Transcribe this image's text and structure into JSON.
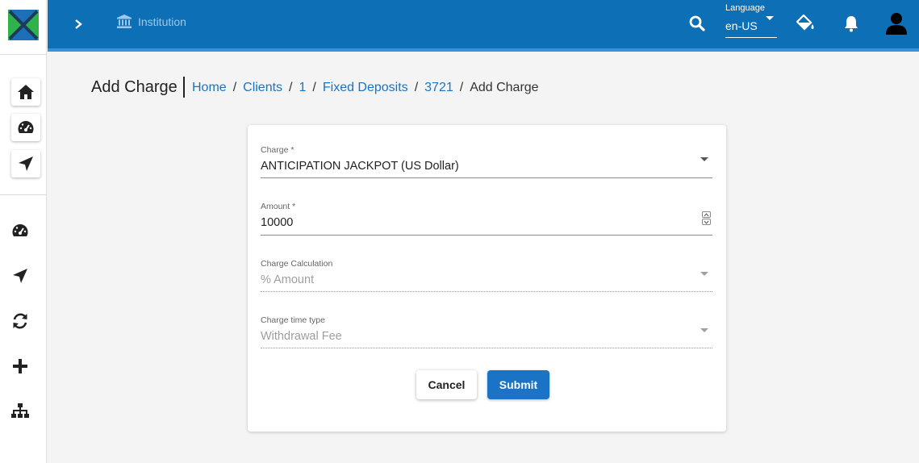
{
  "topbar": {
    "institution_label": "Institution",
    "language_label": "Language",
    "language_value": "en-US"
  },
  "sidebar": {
    "quick_buttons": [
      "home-icon",
      "dashboard-icon",
      "navigation-icon"
    ],
    "nav_icons": [
      "dashboard-icon",
      "navigation-icon",
      "refresh-icon",
      "plus-icon",
      "sitemap-icon"
    ]
  },
  "header": {
    "title": "Add Charge",
    "breadcrumb": {
      "home": "Home",
      "clients": "Clients",
      "client_id": "1",
      "fixed_deposits": "Fixed Deposits",
      "account_id": "3721",
      "current": "Add Charge",
      "separator": "/"
    }
  },
  "form": {
    "charge": {
      "label": "Charge *",
      "value": "ANTICIPATION JACKPOT (US Dollar)"
    },
    "amount": {
      "label": "Amount *",
      "value": "10000"
    },
    "charge_calculation": {
      "label": "Charge Calculation",
      "value": "% Amount"
    },
    "charge_time_type": {
      "label": "Charge time type",
      "value": "Withdrawal Fee"
    },
    "cancel_label": "Cancel",
    "submit_label": "Submit"
  },
  "colors": {
    "topbar": "#0d6fb5",
    "accent": "#1a73c4",
    "background": "#f4f4f4"
  }
}
